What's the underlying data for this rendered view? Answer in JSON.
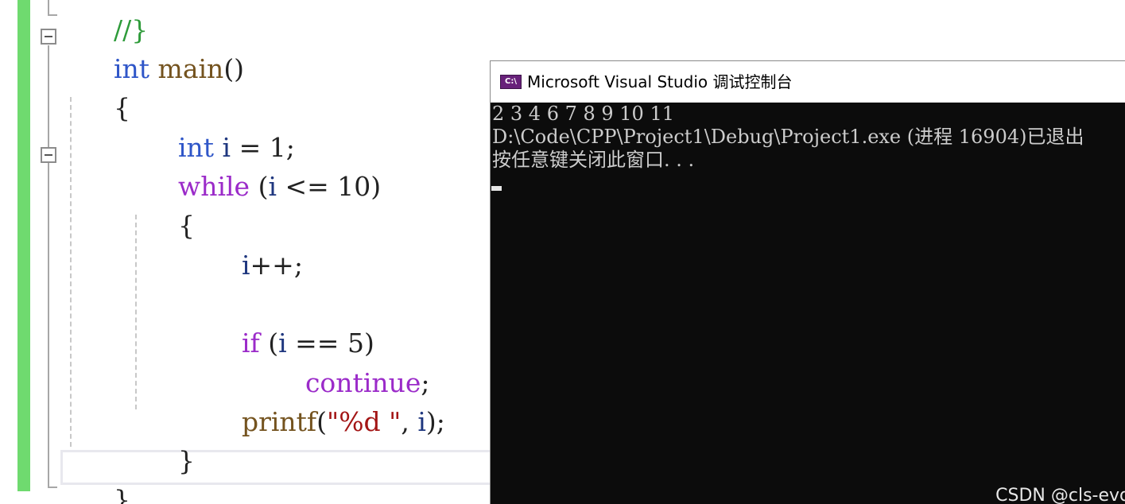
{
  "editor": {
    "top_comment": "//}",
    "lines": [
      {
        "t1": "int",
        "t2": " ",
        "t3": "main",
        "t4": "()"
      },
      {
        "brace": "{"
      },
      {
        "t1": "int",
        "t2": " ",
        "t3": "i",
        "t4": " = 1;"
      },
      {
        "t1": "while",
        "t2": " (",
        "t3": "i",
        "t4": " <= 10)"
      },
      {
        "brace": "{"
      },
      {
        "t1": "i",
        "t2": "++;"
      },
      {
        "t1": "if",
        "t2": " (",
        "t3": "i",
        "t4": " == 5)"
      },
      {
        "t1": "continue",
        "t2": ";"
      },
      {
        "t1": "printf",
        "t2": "(",
        "t3": "\"%d \"",
        "t4": ", ",
        "t5": "i",
        "t6": ");"
      },
      {
        "brace": "}"
      },
      {
        "brace": "}"
      }
    ]
  },
  "console": {
    "title": "Microsoft Visual Studio 调试控制台",
    "icon_label": "C:\\",
    "icon_name": "vs-console-icon",
    "output": [
      "2 3 4 6 7 8 9 10 11",
      "D:\\Code\\CPP\\Project1\\Debug\\Project1.exe (进程 16904)已退出",
      "按任意键关闭此窗口. . ."
    ]
  },
  "watermark": "CSDN @cls-evd",
  "colors": {
    "keyword": "#2f56c8",
    "control_keyword": "#9b2bc9",
    "function": "#74531f",
    "variable": "#1f377f",
    "string": "#a31515",
    "change_bar": "#6fda6f",
    "console_bg": "#0c0c0c",
    "console_text": "#cccccc"
  }
}
